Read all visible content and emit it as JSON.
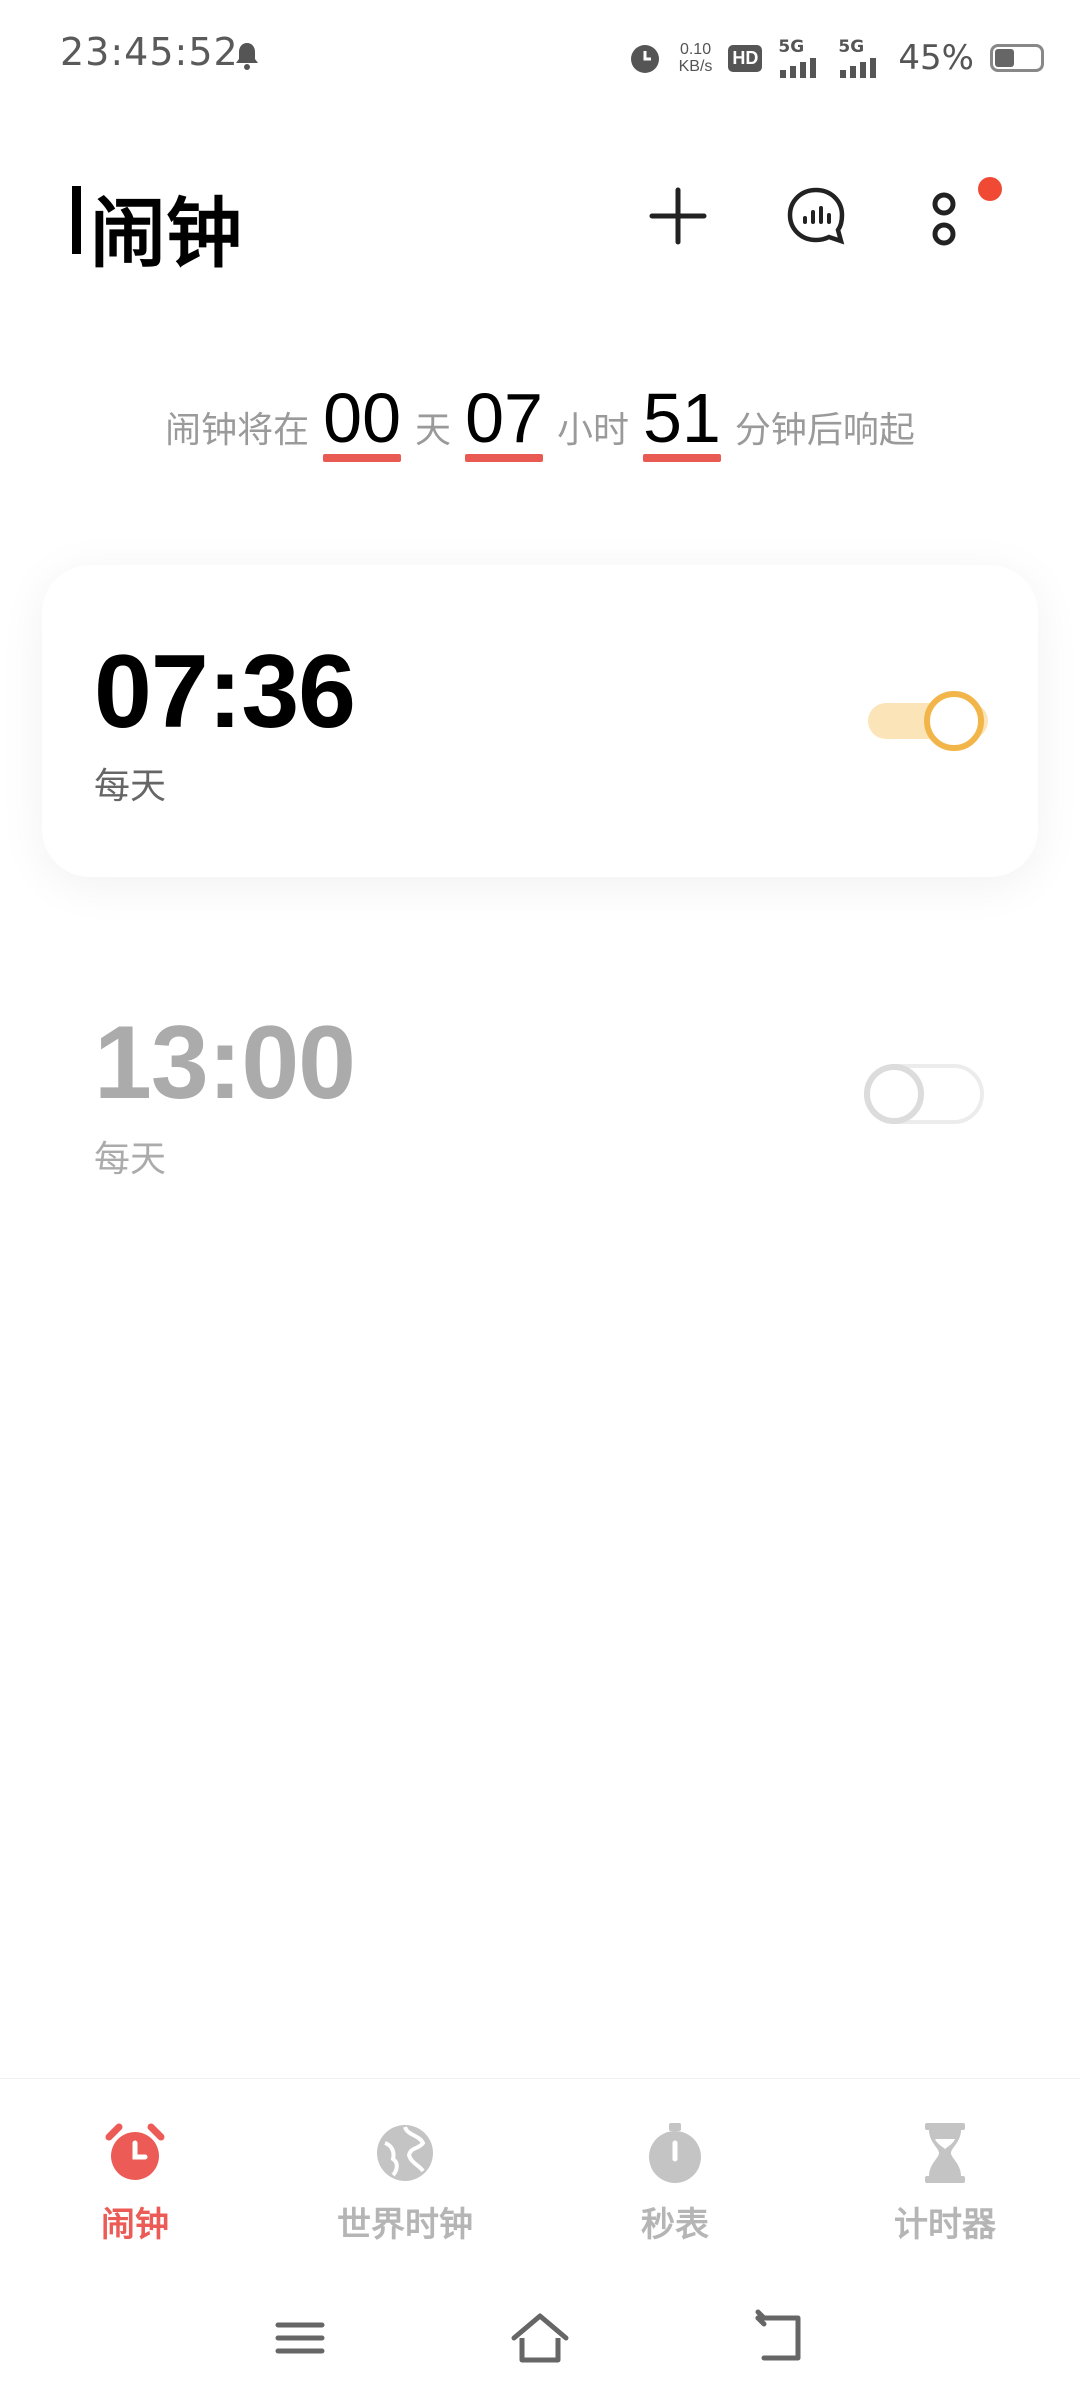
{
  "status_bar": {
    "time": "23:45:52",
    "net_speed_value": "0.10",
    "net_speed_unit": "KB/s",
    "hd_badge": "HD",
    "signal1_label": "5G",
    "signal2_label": "5G",
    "battery_percent": "45%",
    "battery_level": 0.45
  },
  "header": {
    "title": "闹钟",
    "icons": [
      "plus-icon",
      "voice-broadcast-icon",
      "more-options-icon"
    ],
    "notification_dot_color": "#f04a34"
  },
  "countdown": {
    "prefix": "闹钟将在",
    "days": "00",
    "days_unit": "天",
    "hours": "07",
    "hours_unit": "小时",
    "minutes": "51",
    "minutes_unit": "分钟后响起"
  },
  "alarms": [
    {
      "time": "07:36",
      "repeat": "每天",
      "enabled": true
    },
    {
      "time": "13:00",
      "repeat": "每天",
      "enabled": false
    }
  ],
  "tabs": [
    {
      "label": "闹钟",
      "icon": "alarm-clock-icon",
      "active": true
    },
    {
      "label": "世界时钟",
      "icon": "globe-icon",
      "active": false
    },
    {
      "label": "秒表",
      "icon": "stopwatch-icon",
      "active": false
    },
    {
      "label": "计时器",
      "icon": "hourglass-icon",
      "active": false
    }
  ],
  "nav_bar": {
    "icons": [
      "menu-icon",
      "home-icon",
      "back-icon"
    ]
  },
  "colors": {
    "accent": "#ec5b55",
    "toggle_on_knob": "#f2b54a",
    "toggle_on_track": "#fbe5b8",
    "inactive_text": "#ababab",
    "inactive_tab": "#b5b5b5"
  }
}
